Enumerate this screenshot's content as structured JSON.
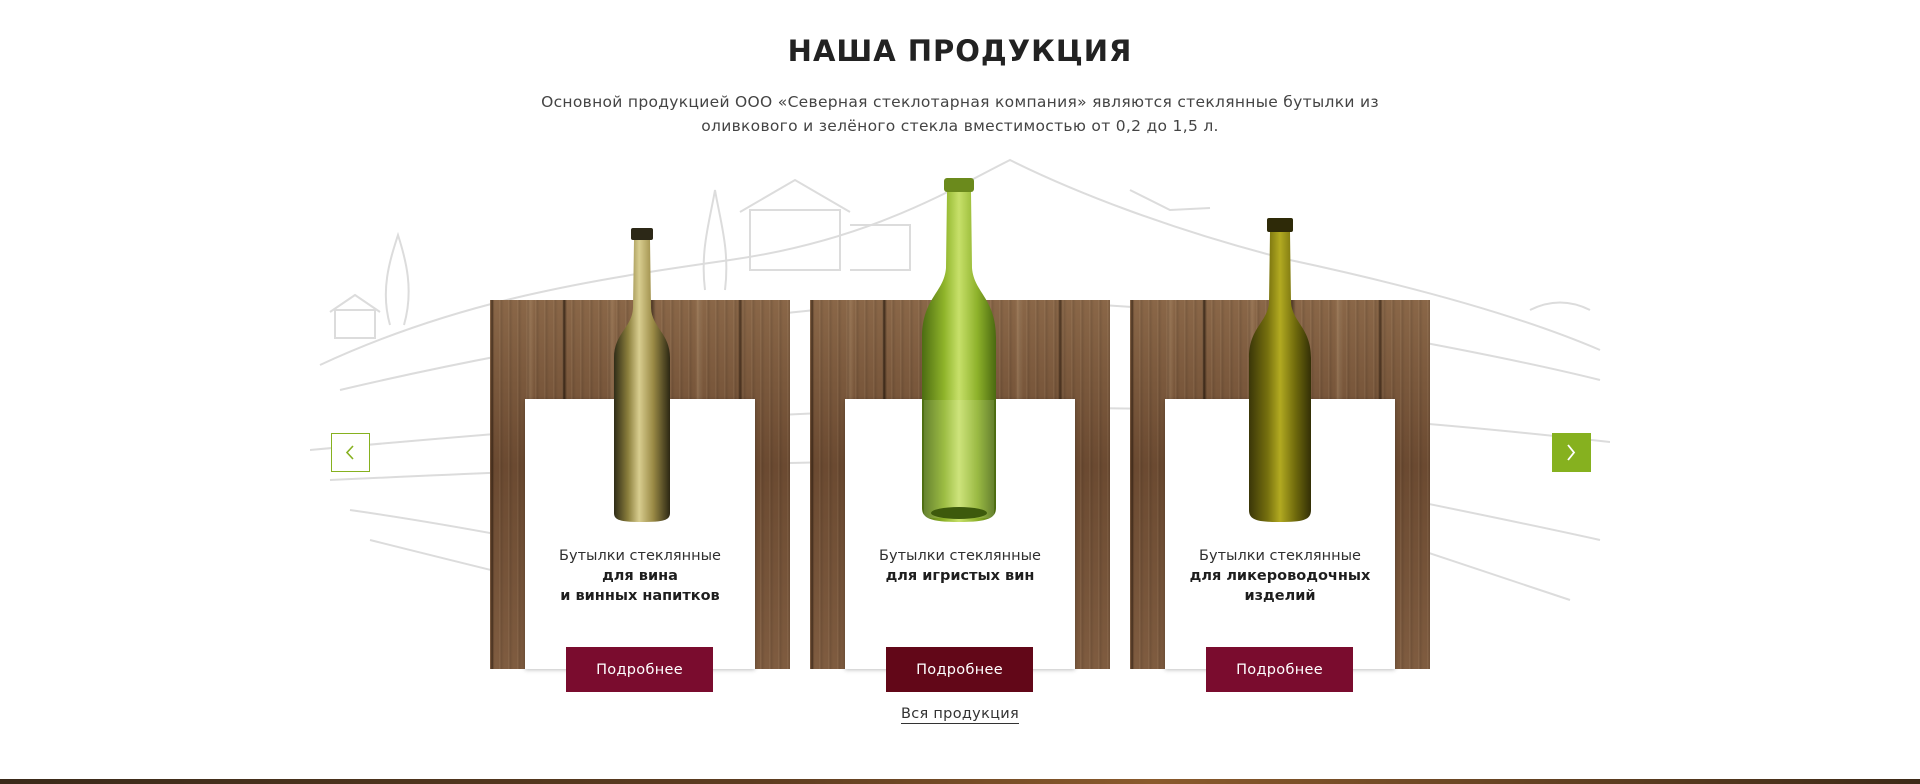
{
  "section": {
    "title": "НАША ПРОДУКЦИЯ",
    "subtitle": "Основной продукцией ООО «Северная стеклотарная компания» являются стеклянные бутылки из оливкового и зелёного стекла вместимостью от 0,2 до 1,5 л."
  },
  "carousel": {
    "prev_icon": "chevron-left-icon",
    "next_icon": "chevron-right-icon",
    "accent_color": "#86b11f",
    "button_color": "#7a0c2e",
    "products": [
      {
        "line1": "Бутылки стеклянные",
        "line2": "для вина",
        "line3": "и винных напитков",
        "button": "Подробнее",
        "bottle_color": "olive-gold"
      },
      {
        "line1": "Бутылки стеклянные",
        "line2": "для игристых вин",
        "line3": "",
        "button": "Подробнее",
        "bottle_color": "light-green"
      },
      {
        "line1": "Бутылки стеклянные",
        "line2": "для ликероводочных",
        "line3": "изделий",
        "button": "Подробнее",
        "bottle_color": "olive"
      }
    ]
  },
  "all_products_link": "Вся продукция"
}
